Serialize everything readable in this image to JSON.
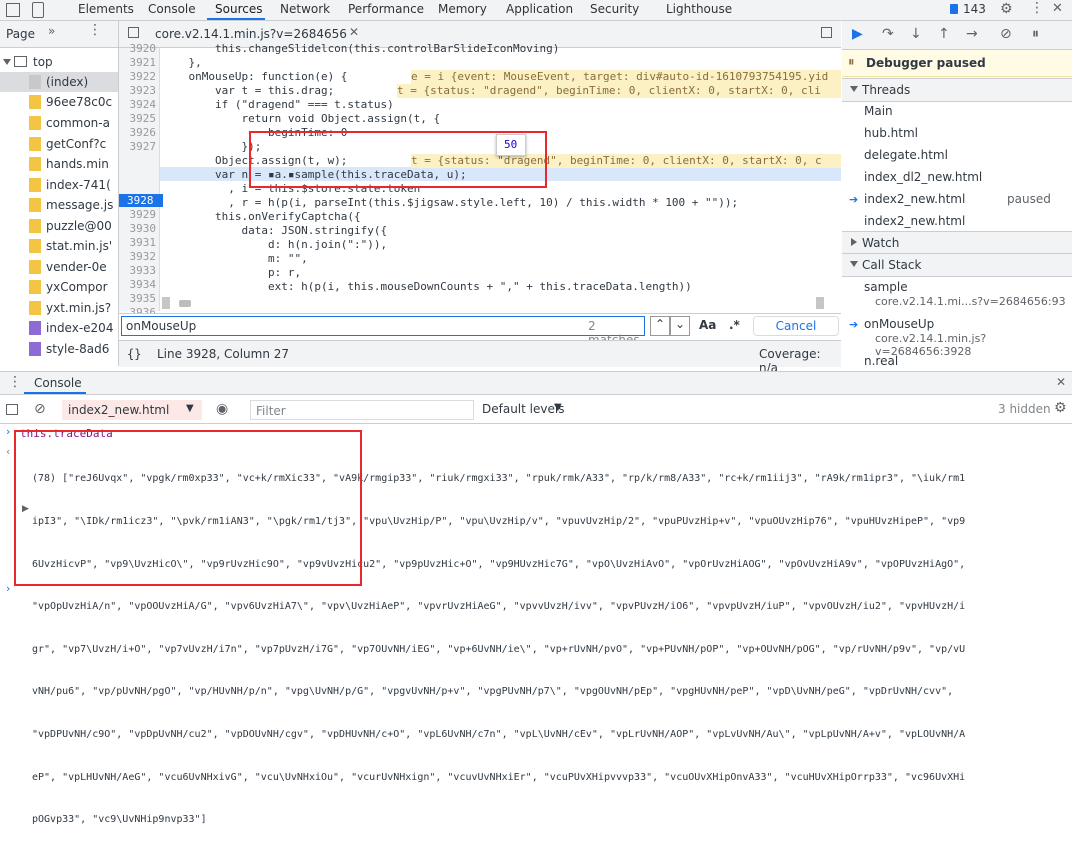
{
  "top_tabs": {
    "items": [
      "Elements",
      "Console",
      "Sources",
      "Network",
      "Performance",
      "Memory",
      "Application",
      "Security",
      "Lighthouse"
    ],
    "active": "Sources",
    "issues_count": "143"
  },
  "navigator": {
    "tab_label": "Page",
    "rows": [
      {
        "label": "top"
      },
      {
        "label": "(index)"
      },
      {
        "label": "96ee78c0c"
      },
      {
        "label": "common-a"
      },
      {
        "label": "getConf?c"
      },
      {
        "label": "hands.min"
      },
      {
        "label": "index-741("
      },
      {
        "label": "message.js"
      },
      {
        "label": "puzzle@00"
      },
      {
        "label": "stat.min.js'"
      },
      {
        "label": "vender-0e"
      },
      {
        "label": "yxCompor"
      },
      {
        "label": "yxt.min.js?"
      },
      {
        "label": "index-e204"
      },
      {
        "label": "style-8ad6"
      }
    ]
  },
  "editor": {
    "file_tab": "core.v2.14.1.min.js?v=2684656",
    "line_numbers": [
      "3920",
      "3921",
      "3922",
      "3923",
      "3924",
      "3925",
      "3926",
      "3927",
      "3928",
      "3929",
      "3930",
      "3931",
      "3932",
      "3933",
      "3934",
      "3935",
      "3936",
      "3937"
    ],
    "lines": [
      "        this.changeSlidelcon(this.controlBarSlideIconMoving)",
      "    },",
      "    onMouseUp: function(e) {",
      "        var t = this.drag;",
      "        if (\"dragend\" === t.status)",
      "            return void Object.assign(t, {",
      "                beginTime: 0",
      "            });",
      "        Object.assign(t, w);",
      "        var n = ▪a.▪sample(this.traceData, u);",
      "          , i = this.$store.state.token",
      "          , r = h(p(i, parseInt(this.$jigsaw.style.left, 10) / this.width * 100 + \"\"));",
      "        this.onVerifyCaptcha({",
      "            data: JSON.stringify({",
      "                d: h(n.join(\":\")),",
      "                m: \"\",",
      "                p: r,",
      "                ext: h(p(i, this.mouseDownCounts + \",\" + this.traceData.length))"
    ],
    "inline_values": {
      "line3921": "e = i {event: MouseEvent, target: div#auto-id-1610793754195.yid",
      "line3922": "t = {status: \"dragend\", beginTime: 0, clientX: 0, startX: 0, cli",
      "line3927": "t = {status: \"dragend\", beginTime: 0, clientX: 0, startX: 0, c"
    },
    "hover_tooltip": "50",
    "search_query": "onMouseUp",
    "match_count": "2 matches",
    "aa_label": "Aa",
    "regex_label": ".*",
    "cancel_label": "Cancel",
    "cursor_position": "Line 3928, Column 27",
    "coverage": "Coverage: n/a",
    "braces_label": "{}"
  },
  "debugger": {
    "paused_banner": "Debugger paused",
    "threads_header": "Threads",
    "threads": [
      {
        "name": "Main",
        "status": ""
      },
      {
        "name": "hub.html",
        "status": ""
      },
      {
        "name": "delegate.html",
        "status": ""
      },
      {
        "name": "index_dl2_new.html",
        "status": ""
      },
      {
        "name": "index2_new.html",
        "status": "paused"
      },
      {
        "name": "index2_new.html",
        "status": ""
      }
    ],
    "watch_header": "Watch",
    "callstack_header": "Call Stack",
    "frames": [
      {
        "fn": "sample",
        "loc": "core.v2.14.1.mi...s?v=2684656:93"
      },
      {
        "fn": "onMouseUp",
        "loc": "core.v2.14.1.min.js?v=2684656:3928"
      },
      {
        "fn": "n.real",
        "loc": ""
      }
    ]
  },
  "console": {
    "tab_label": "Console",
    "context": "index2_new.html",
    "filter_placeholder": "Filter",
    "levels": "Default levels",
    "hidden": "3 hidden",
    "command": "this.traceData",
    "output_lines": [
      "(78) [\"reJ6Uvqx\", \"vpgk/rm0xp33\", \"vc+k/rmXic33\", \"vA9k/rmgip33\", \"riuk/rmgxi33\", \"rpuk/rmk/A33\", \"rp/k/rm8/A33\", \"rc+k/rm1iij3\", \"rA9k/rm1ipr3\", \"\\iuk/rm1",
      "ipI3\", \"\\IDk/rm1icz3\", \"\\pvk/rm1iAN3\", \"\\pgk/rm1/tj3\", \"vpu\\UvzHip/P\", \"vpu\\UvzHip/v\", \"vpuvUvzHip/2\", \"vpuPUvzHip+v\", \"vpuOUvzHip76\", \"vpuHUvzHipeP\", \"vp9",
      "6UvzHicvP\", \"vp9\\UvzHicO\\\", \"vp9rUvzHic9O\", \"vp9vUvzHicu2\", \"vp9pUvzHic+O\", \"vp9HUvzHic7G\", \"vpO\\UvzHiAvO\", \"vpOrUvzHiAOG\", \"vpOvUvzHiA9v\", \"vpOPUvzHiAgO\",",
      "\"vpOpUvzHiA/n\", \"vpOOUvzHiA/G\", \"vpv6UvzHiA7\\\", \"vpv\\UvzHiAeP\", \"vpvrUvzHiAeG\", \"vpvvUvzH/ivv\", \"vpvPUvzH/iO6\", \"vpvpUvzH/iuP\", \"vpvOUvzH/iu2\", \"vpvHUvzH/i",
      "gr\", \"vp7\\UvzH/i+O\", \"vp7vUvzH/i7n\", \"vp7pUvzH/i7G\", \"vp7OUvNH/iEG\", \"vp+6UvNH/ie\\\", \"vp+rUvNH/pvO\", \"vp+PUvNH/pOP\", \"vp+OUvNH/pOG\", \"vp/rUvNH/p9v\", \"vp/vU",
      "vNH/pu6\", \"vp/pUvNH/pgO\", \"vp/HUvNH/p/n\", \"vpg\\UvNH/p/G\", \"vpgvUvNH/p+v\", \"vpgPUvNH/p7\\\", \"vpgOUvNH/pEp\", \"vpgHUvNH/peP\", \"vpD\\UvNH/peG\", \"vpDrUvNH/cvv\",",
      "\"vpDPUvNH/c9O\", \"vpDpUvNH/cu2\", \"vpDOUvNH/cgv\", \"vpDHUvNH/c+O\", \"vpL6UvNH/c7n\", \"vpL\\UvNH/cEv\", \"vpLrUvNH/AOP\", \"vpLvUvNH/Au\\\", \"vpLpUvNH/A+v\", \"vpLOUvNH/A",
      "eP\", \"vpLHUvNH/AeG\", \"vcu6UvNHxivG\", \"vcu\\UvNHxiOu\", \"vcurUvNHxign\", \"vcuvUvNHxiEr\", \"vcuPUvXHipvvvp33\", \"vcuOUvXHipOnvA33\", \"vcuHUvXHipOrrp33\", \"vc96UvXHi",
      "pOGvp33\", \"vc9\\UvNHip9nvp33\"]"
    ]
  }
}
